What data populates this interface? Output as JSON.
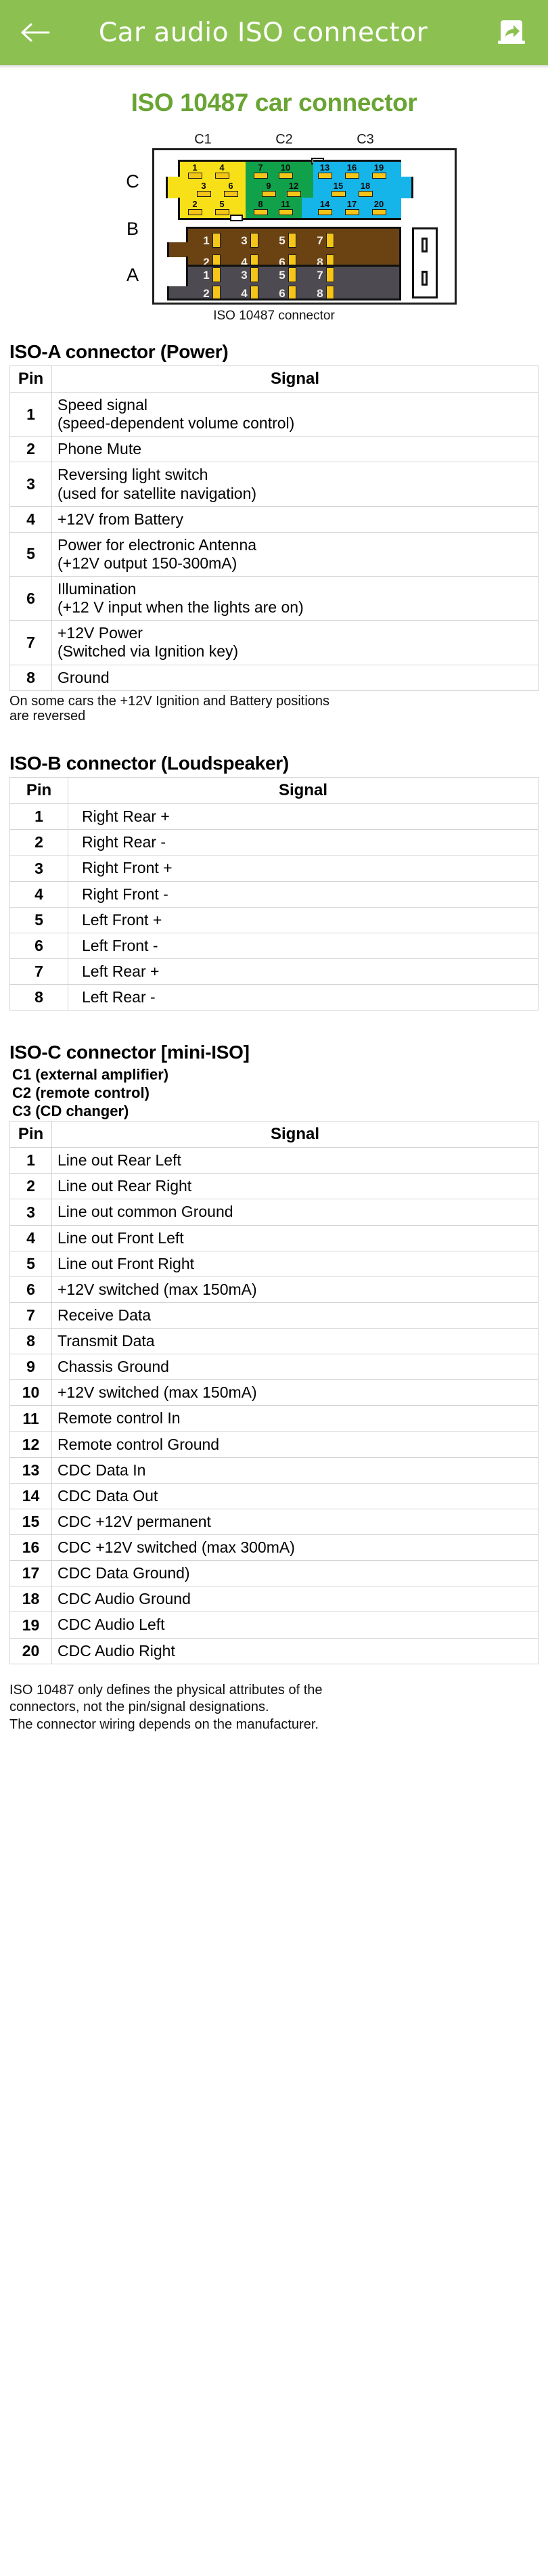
{
  "appbar": {
    "back_icon": "back-arrow-icon",
    "title": "Car audio ISO connector",
    "share_icon": "share-icon",
    "background_color": "#8cc152"
  },
  "page": {
    "title": "ISO 10487 car connector",
    "title_color": "#6aa434"
  },
  "diagram": {
    "caption": "ISO 10487 connector",
    "row_labels": [
      "C",
      "B",
      "A"
    ],
    "col_labels": [
      "C1",
      "C2",
      "C3"
    ],
    "colors": {
      "c1": "#f7e017",
      "c2": "#12a14b",
      "c3": "#15b4e9",
      "b": "#6b4312",
      "a": "#4d4a51",
      "pin": "#f5c518"
    },
    "c1_pins": [
      "1",
      "4",
      "3",
      "6",
      "2",
      "5"
    ],
    "c2_pins": [
      "7",
      "10",
      "9",
      "12",
      "8",
      "11"
    ],
    "c3_pins": [
      "13",
      "16",
      "19",
      "15",
      "18",
      "14",
      "17",
      "20"
    ],
    "b_pins": [
      "1",
      "3",
      "5",
      "7",
      "2",
      "4",
      "6",
      "8"
    ],
    "a_pins": [
      "1",
      "3",
      "5",
      "7",
      "2",
      "4",
      "6",
      "8"
    ]
  },
  "iso_a": {
    "heading": "ISO-A connector (Power)",
    "columns": [
      "Pin",
      "Signal"
    ],
    "rows": [
      {
        "pin": "1",
        "signal": "Speed signal\n(speed-dependent volume control)"
      },
      {
        "pin": "2",
        "signal": "Phone Mute"
      },
      {
        "pin": "3",
        "signal": "Reversing light switch\n(used for satellite navigation)"
      },
      {
        "pin": "4",
        "signal": "+12V from Battery"
      },
      {
        "pin": "5",
        "signal": "Power for electronic Antenna\n(+12V output 150-300mA)"
      },
      {
        "pin": "6",
        "signal": "Illumination\n(+12 V input when the lights are on)"
      },
      {
        "pin": "7",
        "signal": "+12V Power\n(Switched via Ignition key)"
      },
      {
        "pin": "8",
        "signal": "Ground"
      }
    ],
    "note": "On some cars the +12V Ignition and Battery positions\nare reversed"
  },
  "iso_b": {
    "heading": "ISO-B connector (Loudspeaker)",
    "columns": [
      "Pin",
      "Signal"
    ],
    "rows": [
      {
        "pin": "1",
        "signal": "Right Rear +"
      },
      {
        "pin": "2",
        "signal": "Right Rear -"
      },
      {
        "pin": "3",
        "signal": "Right Front +"
      },
      {
        "pin": "4",
        "signal": "Right Front -"
      },
      {
        "pin": "5",
        "signal": "Left Front +"
      },
      {
        "pin": "6",
        "signal": "Left Front -"
      },
      {
        "pin": "7",
        "signal": "Left Rear +"
      },
      {
        "pin": "8",
        "signal": "Left Rear -"
      }
    ]
  },
  "iso_c": {
    "heading": "ISO-C connector [mini-ISO]",
    "sublines": [
      "C1 (external amplifier)",
      "C2 (remote control)",
      "C3 (CD changer)"
    ],
    "columns": [
      "Pin",
      "Signal"
    ],
    "rows": [
      {
        "pin": "1",
        "signal": "Line out Rear Left"
      },
      {
        "pin": "2",
        "signal": "Line out Rear Right"
      },
      {
        "pin": "3",
        "signal": "Line out common Ground"
      },
      {
        "pin": "4",
        "signal": "Line out Front Left"
      },
      {
        "pin": "5",
        "signal": "Line out Front Right"
      },
      {
        "pin": "6",
        "signal": "+12V switched (max 150mA)"
      },
      {
        "pin": "7",
        "signal": "Receive Data"
      },
      {
        "pin": "8",
        "signal": "Transmit Data"
      },
      {
        "pin": "9",
        "signal": "Chassis Ground"
      },
      {
        "pin": "10",
        "signal": "+12V switched (max 150mA)"
      },
      {
        "pin": "11",
        "signal": "Remote control In"
      },
      {
        "pin": "12",
        "signal": "Remote control Ground"
      },
      {
        "pin": "13",
        "signal": "CDC Data In"
      },
      {
        "pin": "14",
        "signal": "CDC Data Out"
      },
      {
        "pin": "15",
        "signal": "CDC +12V permanent"
      },
      {
        "pin": "16",
        "signal": "CDC +12V switched (max 300mA)"
      },
      {
        "pin": "17",
        "signal": "CDC Data Ground)"
      },
      {
        "pin": "18",
        "signal": "CDC Audio Ground"
      },
      {
        "pin": "19",
        "signal": "CDC Audio Left"
      },
      {
        "pin": "20",
        "signal": "CDC Audio Right"
      }
    ]
  },
  "footnote": "ISO 10487 only defines the physical attributes of the\nconnectors, not the pin/signal designations.\nThe connector wiring depends on the manufacturer."
}
